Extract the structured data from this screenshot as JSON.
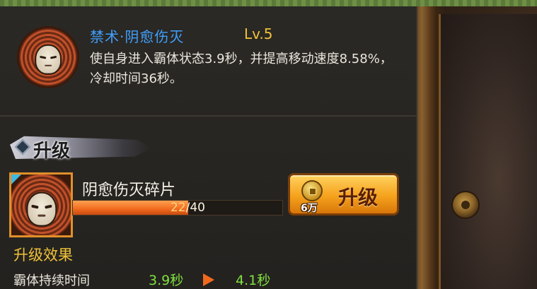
{
  "skill": {
    "name": "禁术·阴愈伤灭",
    "level": "Lv.5",
    "description": "使自身进入霸体状态3.9秒，并提高移动速度8.58%，冷却时间36秒。"
  },
  "upgrade_section": {
    "title": "升级"
  },
  "fragment": {
    "name": "阴愈伤灭碎片",
    "current": "22",
    "total": "/40",
    "progress_fraction": 0.55
  },
  "upgrade_button": {
    "label": "升级",
    "cost": "6万",
    "icon": "coin-icon"
  },
  "effect": {
    "title": "升级效果",
    "rows": [
      {
        "label": "霸体持续时间",
        "current": "3.9秒",
        "next": "4.1秒"
      }
    ]
  },
  "colors": {
    "skill_name": "#3fa0ff",
    "level": "#f0c238",
    "value_green": "#7fe040",
    "progress_orange": "#f06a1e",
    "button_gold": "#f5a21c"
  }
}
